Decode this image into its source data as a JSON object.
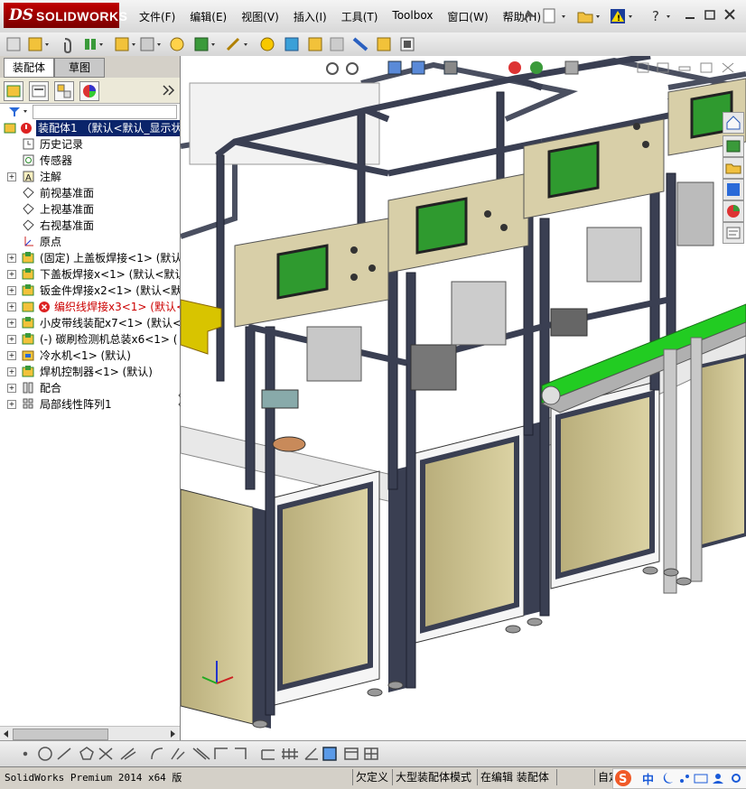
{
  "app": {
    "logo_ds": "DS",
    "logo_name": "SOLIDWORKS"
  },
  "menu": [
    "文件(F)",
    "编辑(E)",
    "视图(V)",
    "插入(I)",
    "工具(T)",
    "Toolbox",
    "窗口(W)",
    "帮助(H)"
  ],
  "tabs": {
    "assembly": "装配体",
    "sketch": "草图"
  },
  "feature_tree": {
    "root": "装配体1 （默认<默认_显示状",
    "items": [
      {
        "label": "历史记录",
        "icon": "history-icon",
        "expandable": false,
        "color": "#000000"
      },
      {
        "label": "传感器",
        "icon": "sensor-icon",
        "expandable": false,
        "color": "#000000"
      },
      {
        "label": "注解",
        "icon": "annotation-icon",
        "expandable": true,
        "color": "#000000"
      },
      {
        "label": "前视基准面",
        "icon": "plane-icon",
        "expandable": false,
        "color": "#000000"
      },
      {
        "label": "上视基准面",
        "icon": "plane-icon",
        "expandable": false,
        "color": "#000000"
      },
      {
        "label": "右视基准面",
        "icon": "plane-icon",
        "expandable": false,
        "color": "#000000"
      },
      {
        "label": "原点",
        "icon": "origin-icon",
        "expandable": false,
        "color": "#000000"
      },
      {
        "label": "(固定) 上盖板焊接<1> (默认",
        "icon": "assembly-icon",
        "expandable": true,
        "color": "#000000"
      },
      {
        "label": "下盖板焊接x<1> (默认<默认",
        "icon": "assembly-icon",
        "expandable": true,
        "color": "#000000"
      },
      {
        "label": "钣金件焊接x2<1> (默认<默认",
        "icon": "assembly-icon",
        "expandable": true,
        "color": "#000000"
      },
      {
        "label": "编织线焊接x3<1> (默认<9",
        "icon": "error-icon",
        "expandable": true,
        "color": "#cc0000"
      },
      {
        "label": "小皮带线装配x7<1> (默认<",
        "icon": "assembly-icon",
        "expandable": true,
        "color": "#000000"
      },
      {
        "label": "(-) 碳刷检测机总装x6<1> (",
        "icon": "assembly-icon",
        "expandable": true,
        "color": "#000000"
      },
      {
        "label": "冷水机<1> (默认)",
        "icon": "part-icon",
        "expandable": true,
        "color": "#000000"
      },
      {
        "label": "焊机控制器<1> (默认)",
        "icon": "assembly-icon",
        "expandable": true,
        "color": "#000000"
      },
      {
        "label": "配合",
        "icon": "mates-icon",
        "expandable": true,
        "color": "#000000"
      },
      {
        "label": "局部线性阵列1",
        "icon": "pattern-icon",
        "expandable": true,
        "color": "#000000"
      }
    ]
  },
  "status": {
    "product": "SolidWorks Premium 2014 x64 版",
    "underdefined": "欠定义",
    "large_assembly": "大型装配体模式",
    "editing": "在编辑 装配体",
    "custom": "自定义"
  },
  "ime": {
    "lang": "中"
  },
  "colors": {
    "accent": "#c00000",
    "conveyor": "#22cc22",
    "frame": "#3a3f52",
    "panel": "#d8cfa8",
    "selection": "#0a246a"
  }
}
